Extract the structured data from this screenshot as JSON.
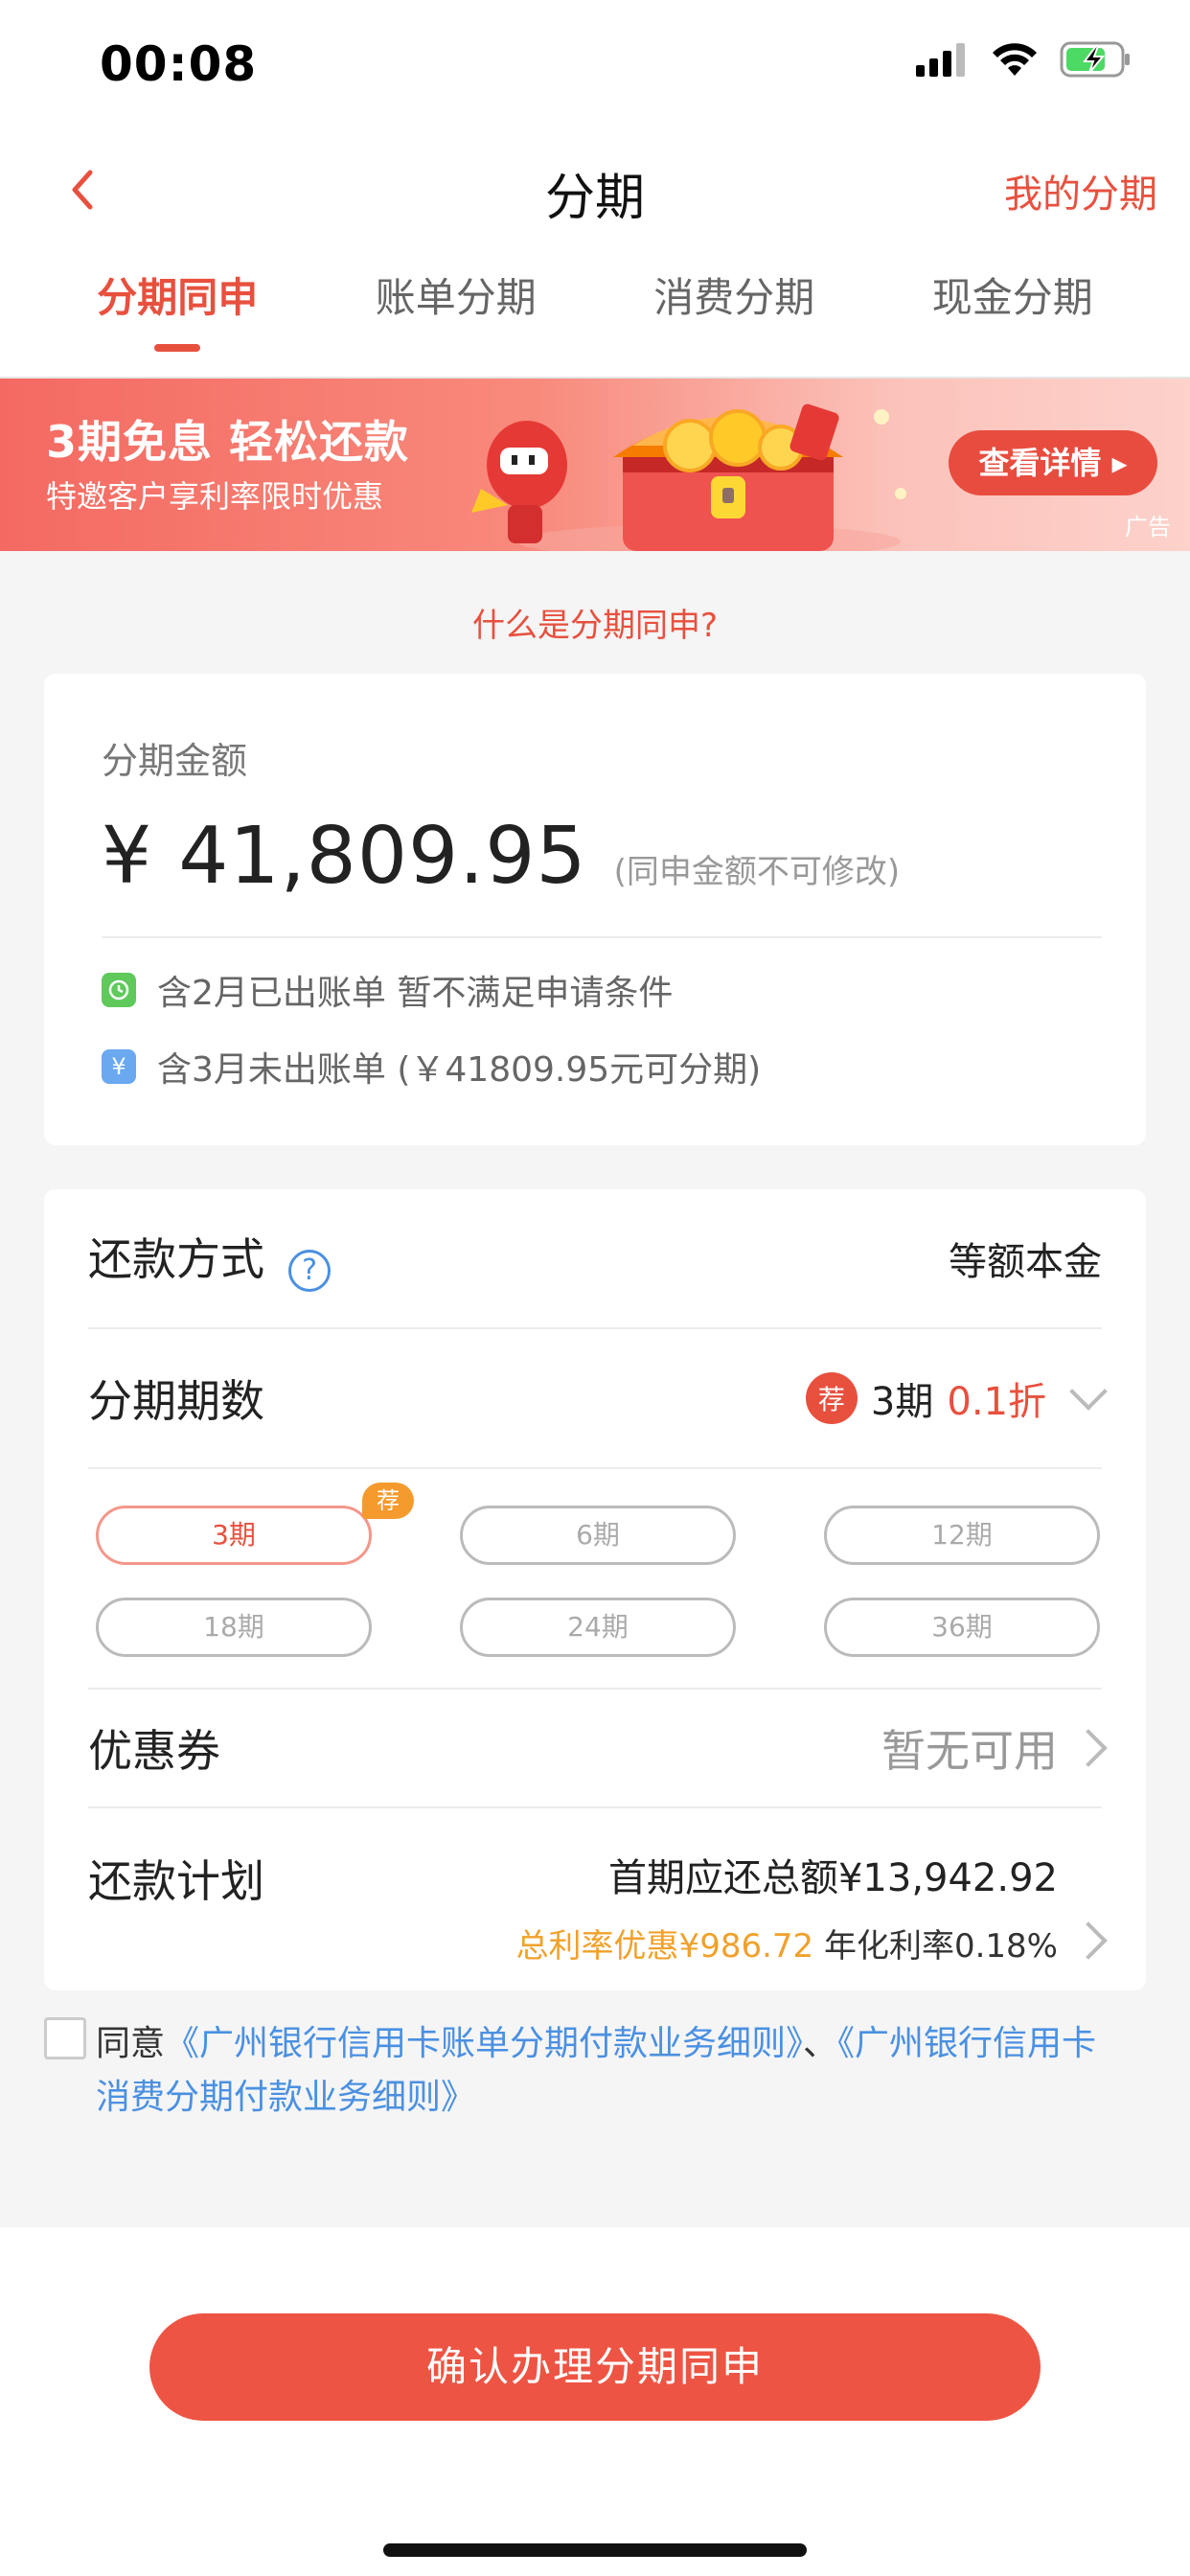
{
  "status_bar": {
    "time": "00:08"
  },
  "nav": {
    "title": "分期",
    "right_link": "我的分期"
  },
  "tabs": [
    {
      "label": "分期同申",
      "active": true
    },
    {
      "label": "账单分期",
      "active": false
    },
    {
      "label": "消费分期",
      "active": false
    },
    {
      "label": "现金分期",
      "active": false
    }
  ],
  "banner": {
    "title": "3期免息 轻松还款",
    "subtitle": "特邀客户享利率限时优惠",
    "button": "查看详情 ▸",
    "ad_label": "广告"
  },
  "what_is_link": "什么是分期同申?",
  "amount_card": {
    "label": "分期金额",
    "value": "¥ 41,809.95",
    "note": "(同申金额不可修改)",
    "info": [
      {
        "text": "含2月已出账单 暂不满足申请条件",
        "icon": "clock-icon",
        "color": "#5fc95c"
      },
      {
        "text": "含3月未出账单 (￥41809.95元可分期)",
        "icon": "yen-icon",
        "color": "#6aa8f0"
      }
    ]
  },
  "repay_method": {
    "label": "还款方式",
    "help": "?",
    "value": "等额本金"
  },
  "installments": {
    "label": "分期期数",
    "badge": "荐",
    "selected_term": "3期",
    "discount": "0.1折",
    "options": [
      "3期",
      "6期",
      "12期",
      "18期",
      "24期",
      "36期"
    ],
    "recommended_tag": "荐"
  },
  "coupon": {
    "label": "优惠券",
    "value": "暂无可用"
  },
  "plan": {
    "label": "还款计划",
    "first_total": "首期应还总额¥13,942.92",
    "discount": "总利率优惠¥986.72",
    "annual_rate": "年化利率0.18%"
  },
  "agreement": {
    "prefix": "同意",
    "link1": "《广州银行信用卡账单分期付款业务细则》",
    "sep": "、",
    "link2": "《广州银行信用卡消费分期付款业务细则》"
  },
  "confirm_button": "确认办理分期同申",
  "colors": {
    "accent": "#e8503e",
    "link": "#4a90e2",
    "orange": "#f0a12b"
  }
}
